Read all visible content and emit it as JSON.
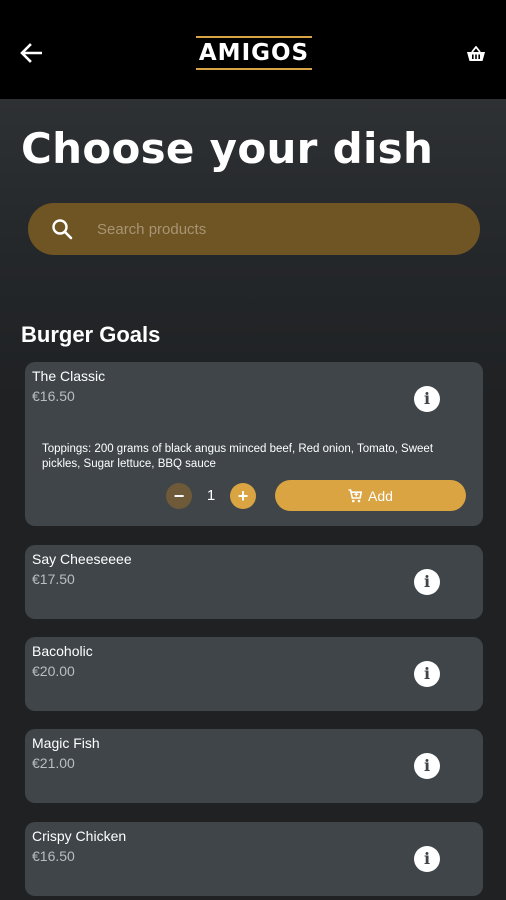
{
  "header": {
    "logo_text": "AMIGOS",
    "back_icon": "arrow-left-icon",
    "basket_icon": "basket-icon"
  },
  "page": {
    "title": "Choose your dish"
  },
  "search": {
    "placeholder": "Search products",
    "icon": "search-icon"
  },
  "section": {
    "title": "Burger Goals"
  },
  "products": [
    {
      "name": "The Classic",
      "price": "€16.50",
      "expanded": true,
      "description": "Toppings: 200 grams of black angus minced beef, Red onion, Tomato, Sweet pickles, Sugar lettuce, BBQ sauce",
      "quantity": "1",
      "add_label": "Add"
    },
    {
      "name": "Say Cheeseeee",
      "price": "€17.50"
    },
    {
      "name": "Bacoholic",
      "price": "€20.00"
    },
    {
      "name": "Magic Fish",
      "price": "€21.00"
    },
    {
      "name": "Crispy Chicken",
      "price": "€16.50"
    }
  ],
  "colors": {
    "accent": "#d9a441",
    "search_bg": "#6f5424",
    "card_bg": "#3f4549",
    "topbar_bg": "#000000"
  }
}
